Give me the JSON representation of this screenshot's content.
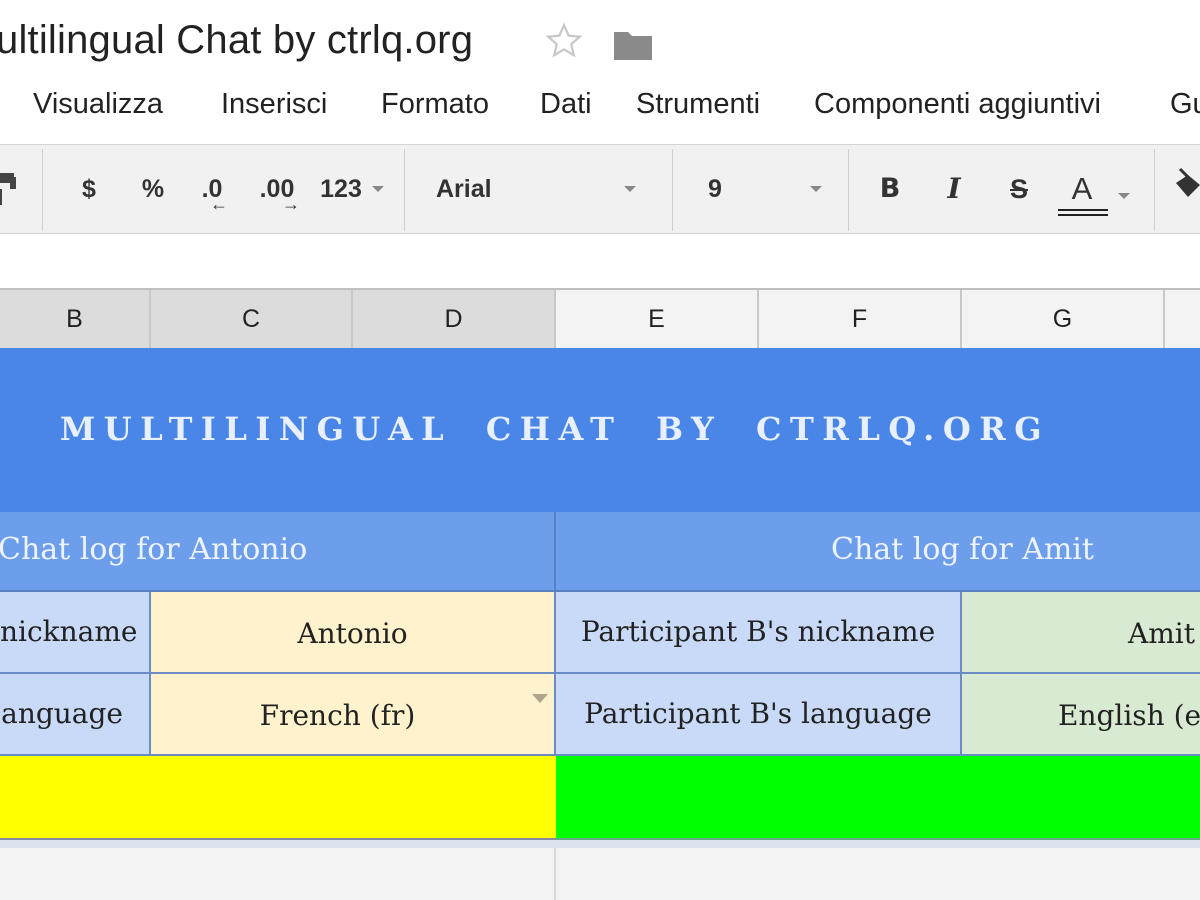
{
  "header": {
    "title": "ultilingual Chat by ctrlq.org",
    "star_icon": "star-outline-icon",
    "folder_icon": "folder-icon"
  },
  "menu": {
    "items": [
      {
        "label": "Visualizza"
      },
      {
        "label": "Inserisci"
      },
      {
        "label": "Formato"
      },
      {
        "label": "Dati"
      },
      {
        "label": "Strumenti"
      },
      {
        "label": "Componenti aggiuntivi"
      },
      {
        "label": "Gu"
      }
    ]
  },
  "toolbar": {
    "paint_format_icon": "paint-format-icon",
    "currency": "$",
    "percent": "%",
    "decrease_decimals": ".0",
    "increase_decimals": ".00",
    "more_formats": "123",
    "font_family": "Arial",
    "font_size": "9",
    "bold": "B",
    "italic": "I",
    "strikethrough": "S",
    "text_color": "A",
    "fill_color_icon": "fill-color-icon"
  },
  "grid": {
    "columns": [
      "B",
      "C",
      "D",
      "E",
      "F",
      "G"
    ],
    "banner": "MULTILINGUAL CHAT BY CTRLQ.ORG",
    "left_panel": {
      "title": "Chat log for Antonio",
      "nickname_label": "nickname",
      "nickname_value": "Antonio",
      "language_label": "anguage",
      "language_value": "French (fr)",
      "highlight_color": "#ffff00"
    },
    "right_panel": {
      "title": "Chat log for Amit",
      "nickname_label": "Participant B's nickname",
      "nickname_value": "Amit",
      "language_label": "Participant B's language",
      "language_value": "English (e",
      "highlight_color": "#00ff00"
    }
  },
  "colors": {
    "banner": "#4a86e8",
    "log_header": "#6d9eeb",
    "label_cell": "#c9daf8",
    "value_a": "#fff2cc",
    "value_b": "#d9ead3"
  }
}
